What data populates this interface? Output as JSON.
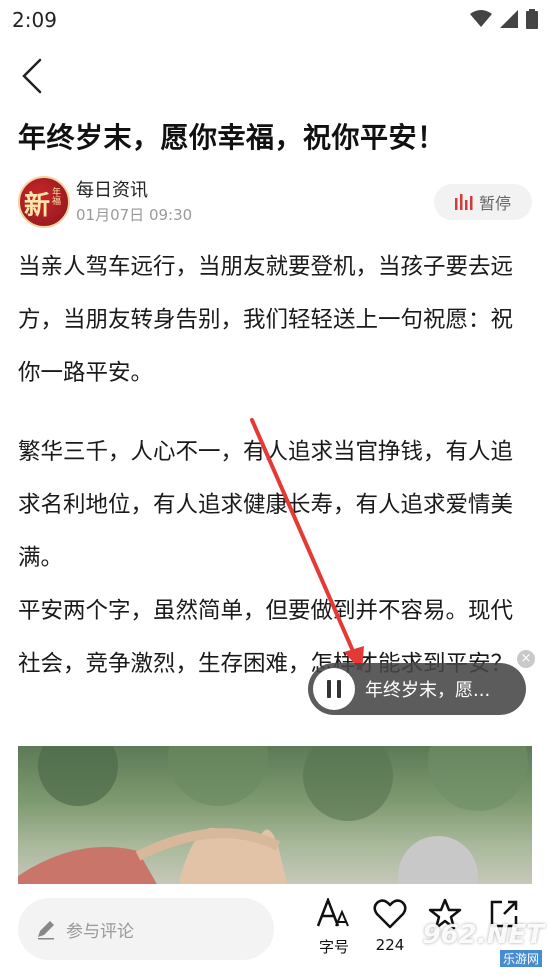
{
  "status": {
    "time": "2:09"
  },
  "article": {
    "title": "年终岁末，愿你幸福，祝你平安！",
    "author": "每日资讯",
    "date": "01月07日 09:30",
    "pause_label": "暂停",
    "p1": "当亲人驾车远行，当朋友就要登机，当孩子要去远方，当朋友转身告别，我们轻轻送上一句祝愿：祝你一路平安。",
    "p2": "繁华三千，人心不一，有人追求当官挣钱，有人追求名利地位，有人追求健康长寿，有人追求爱情美满。",
    "p3": "平安两个字，虽然简单，但要做到并不容易。现代社会，竞争激烈，生存困难，怎样才能求到平安？"
  },
  "player": {
    "text": "年终岁末，愿..."
  },
  "bottom": {
    "comment_placeholder": "参与评论",
    "font_label": "字号",
    "like_count": "224",
    "watermark": "962.NET",
    "watermark_sub": "乐游网"
  },
  "colors": {
    "accent": "#d23b3b",
    "player_bg": "#464646"
  }
}
